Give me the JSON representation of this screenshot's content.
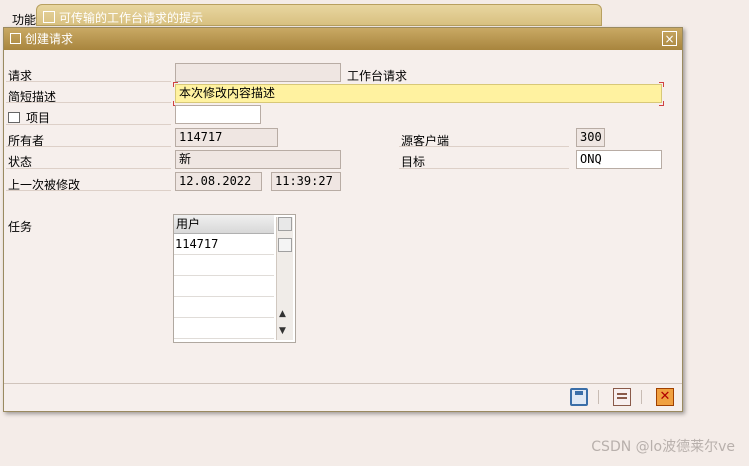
{
  "background": {
    "label": "功能",
    "tab_title": "可传输的工作台请求的提示"
  },
  "dialog": {
    "title": "创建请求",
    "close_symbol": "×"
  },
  "form": {
    "request_label": "请求",
    "request_value": "",
    "request_type": "工作台请求",
    "short_desc_label": "简短描述",
    "short_desc_value": "本次修改内容描述",
    "project_label": "项目",
    "project_value": "",
    "owner_label": "所有者",
    "owner_value": "114717",
    "source_client_label": "源客户端",
    "source_client_value": "300",
    "status_label": "状态",
    "status_value": "新",
    "target_label": "目标",
    "target_value": "ONQ",
    "last_changed_label": "上一次被修改",
    "last_changed_date": "12.08.2022",
    "last_changed_time": "11:39:27",
    "tasks_label": "任务"
  },
  "tasks_table": {
    "header": "用户",
    "rows": [
      "114717",
      "",
      "",
      "",
      ""
    ]
  },
  "toolbar": {
    "save_icon": "save-icon",
    "variant_icon": "list-icon",
    "cancel_symbol": "✕"
  },
  "watermark": "CSDN @lo波德莱尔ve"
}
